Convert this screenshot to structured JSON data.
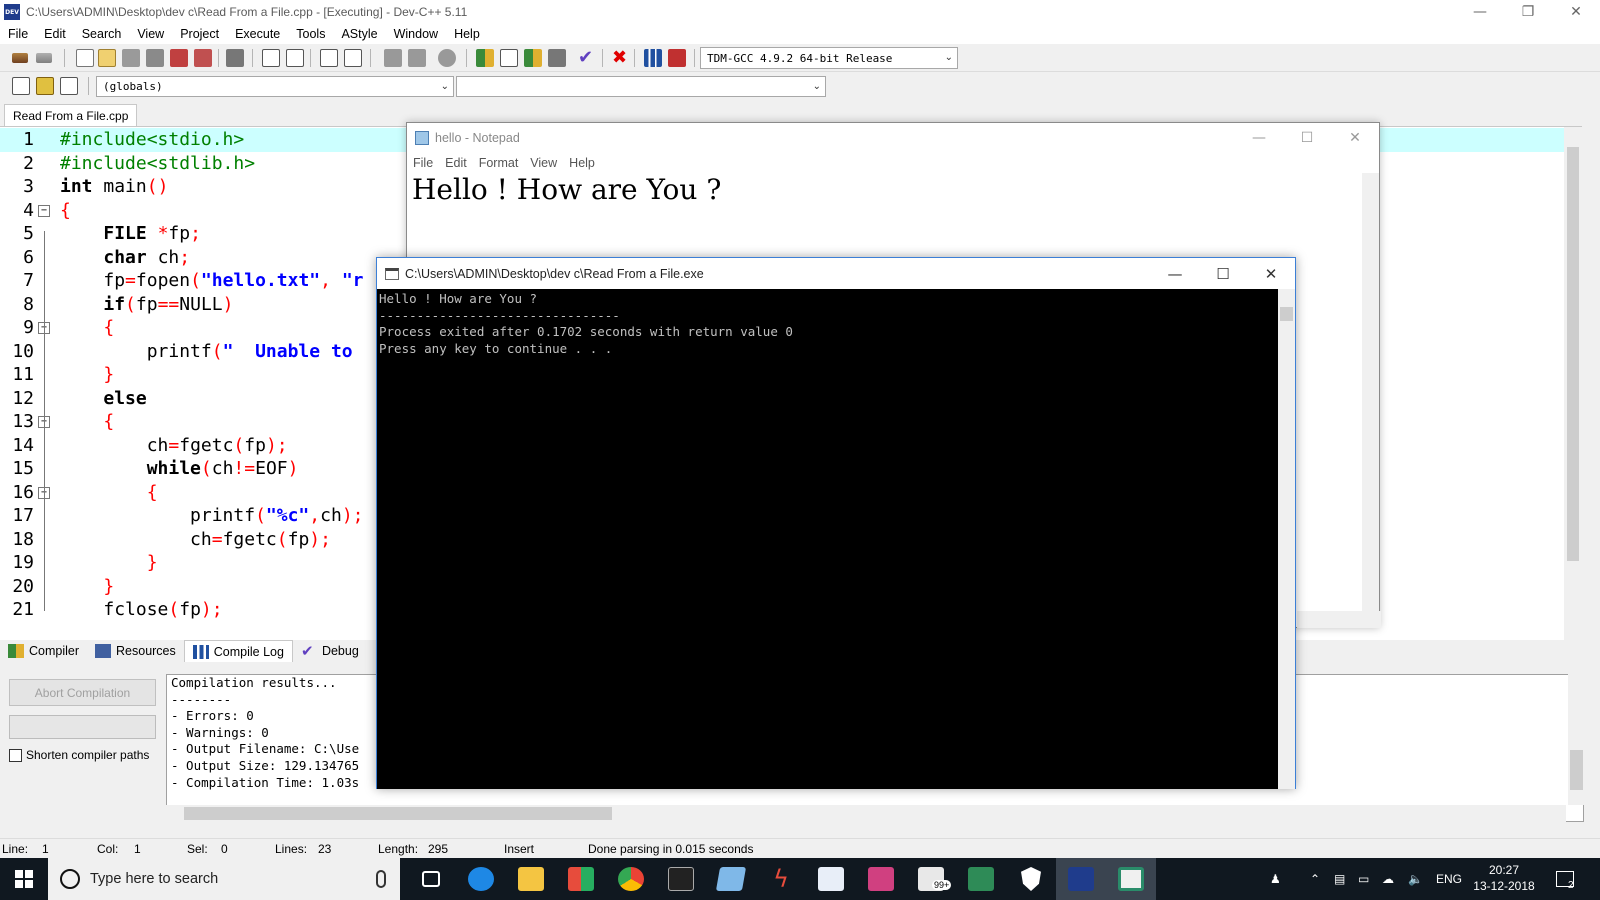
{
  "devcpp": {
    "title": "C:\\Users\\ADMIN\\Desktop\\dev c\\Read From a File.cpp - [Executing] - Dev-C++ 5.11",
    "menu": [
      "File",
      "Edit",
      "Search",
      "View",
      "Project",
      "Execute",
      "Tools",
      "AStyle",
      "Window",
      "Help"
    ],
    "compiler_select": "TDM-GCC 4.9.2 64-bit Release",
    "scope_select": "(globals)",
    "member_select": "",
    "file_tab": "Read From a File.cpp",
    "colors": {
      "current_line": "#ccffff",
      "keyword": "#000000",
      "string": "#0000ff",
      "preprocessor": "#008000",
      "bracket": "#ff0000"
    }
  },
  "code_lines": [
    {
      "n": "1",
      "text": "#include<stdio.h>"
    },
    {
      "n": "2",
      "text": "#include<stdlib.h>"
    },
    {
      "n": "3",
      "text": "int main()"
    },
    {
      "n": "4",
      "text": "{"
    },
    {
      "n": "5",
      "text": "    FILE *fp;"
    },
    {
      "n": "6",
      "text": "    char ch;"
    },
    {
      "n": "7",
      "text": "    fp=fopen(\"hello.txt\", \"r"
    },
    {
      "n": "8",
      "text": "    if(fp==NULL)"
    },
    {
      "n": "9",
      "text": "    {"
    },
    {
      "n": "10",
      "text": "        printf(\"  Unable to"
    },
    {
      "n": "11",
      "text": "    }"
    },
    {
      "n": "12",
      "text": "    else"
    },
    {
      "n": "13",
      "text": "    {"
    },
    {
      "n": "14",
      "text": "        ch=fgetc(fp);"
    },
    {
      "n": "15",
      "text": "        while(ch!=EOF)"
    },
    {
      "n": "16",
      "text": "        {"
    },
    {
      "n": "17",
      "text": "            printf(\"%c\",ch);"
    },
    {
      "n": "18",
      "text": "            ch=fgetc(fp);"
    },
    {
      "n": "19",
      "text": "        }"
    },
    {
      "n": "20",
      "text": "    }"
    },
    {
      "n": "21",
      "text": "    fclose(fp);"
    }
  ],
  "bottom": {
    "tabs": [
      "Compiler",
      "Resources",
      "Compile Log",
      "Debug"
    ],
    "active_tab": "Compile Log",
    "abort_button": "Abort Compilation",
    "shorten_paths": "Shorten compiler paths",
    "log_lines": [
      "Compilation results...",
      "--------",
      "- Errors: 0",
      "- Warnings: 0",
      "- Output Filename: C:\\Use",
      "- Output Size: 129.134765",
      "- Compilation Time: 1.03s"
    ]
  },
  "status": {
    "line_label": "Line:",
    "line_value": "1",
    "col_label": "Col:",
    "col_value": "1",
    "sel_label": "Sel:",
    "sel_value": "0",
    "lines_label": "Lines:",
    "lines_value": "23",
    "length_label": "Length:",
    "length_value": "295",
    "mode": "Insert",
    "message": "Done parsing in 0.015 seconds"
  },
  "notepad": {
    "title": "hello - Notepad",
    "menu": [
      "File",
      "Edit",
      "Format",
      "View",
      "Help"
    ],
    "content": "Hello ! How are You ?"
  },
  "console": {
    "title": "C:\\Users\\ADMIN\\Desktop\\dev c\\Read From a File.exe",
    "lines": [
      "Hello ! How are You ?",
      "--------------------------------",
      "Process exited after 0.1702 seconds with return value 0",
      "Press any key to continue . . ."
    ]
  },
  "taskbar": {
    "search_placeholder": "Type here to search",
    "mail_badge": "99+",
    "language": "ENG",
    "time": "20:27",
    "date": "13-12-2018",
    "notification_count": "2",
    "apps": [
      "task-view",
      "edge",
      "file-explorer",
      "store",
      "chrome",
      "terminal",
      "app-blue",
      "flash",
      "pdf-editor",
      "app-pink",
      "mail",
      "app-green",
      "defender",
      "devcpp",
      "console"
    ]
  }
}
